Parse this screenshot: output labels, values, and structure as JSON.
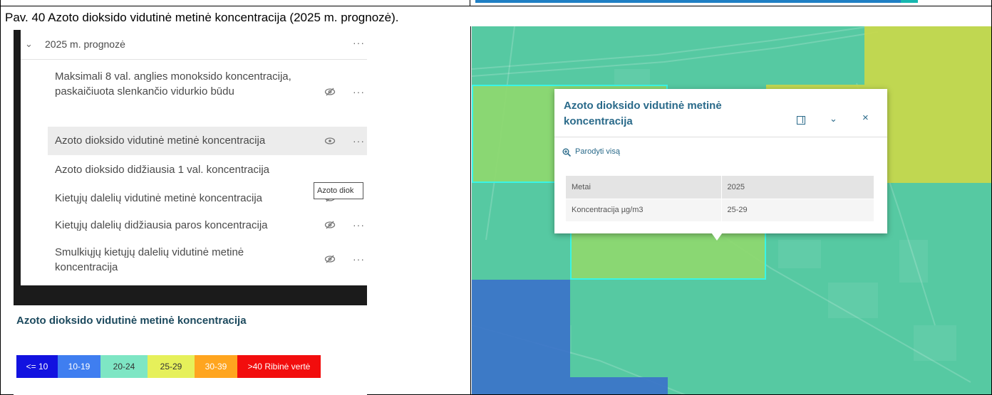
{
  "caption": "Pav. 40 Azoto dioksido vidutinė metinė koncentracija (2025 m. prognozė).",
  "layer_panel": {
    "group": {
      "label": "2025 m. prognozė",
      "expanded": true
    },
    "layers": [
      {
        "label": "Maksimali 8 val. anglies monoksido koncentracija, paskaičiuota slenkančio vidurkio būdu",
        "visible": false
      },
      {
        "label": "Azoto dioksido vidutinė metinė koncentracija",
        "visible": true,
        "selected": true
      },
      {
        "label": "Azoto dioksido didžiausia 1 val. koncentracija",
        "visible": false,
        "tooltip": "Azoto diok"
      },
      {
        "label": "Kietųjų dalelių vidutinė metinė koncentracija",
        "visible": false
      },
      {
        "label": "Kietųjų dalelių didžiausia paros koncentracija",
        "visible": false
      },
      {
        "label": "Smulkiųjų kietųjų dalelių vidutinė metinė koncentracija",
        "visible": false
      }
    ]
  },
  "legend": {
    "title": "Azoto dioksido vidutinė metinė koncentracija",
    "items": [
      {
        "label": "<= 10",
        "color": "#1212e0",
        "text_color": "#ffffff"
      },
      {
        "label": "10-19",
        "color": "#3f7ef0",
        "text_color": "#ffffff"
      },
      {
        "label": "20-24",
        "color": "#7ee6c4",
        "text_color": "#333333"
      },
      {
        "label": "25-29",
        "color": "#e6f05a",
        "text_color": "#333333"
      },
      {
        "label": "30-39",
        "color": "#ffa51f",
        "text_color": "#ffffff"
      },
      {
        "label": ">40 Ribinė vertė",
        "color": "#f20d0d",
        "text_color": "#ffffff"
      }
    ]
  },
  "popup": {
    "title": "Azoto dioksido vidutinė metinė koncentracija",
    "zoom_label": "Parodyti visą",
    "rows": [
      {
        "field": "Metai",
        "value": "2025"
      },
      {
        "field": "Koncentracija µg/m3",
        "value": "25-29"
      }
    ]
  },
  "map_colors": {
    "base": "#56c9a2",
    "lime": "#8ed86f",
    "yellow": "#c9d84a",
    "blue": "#3b73c9",
    "selection": "#39f5e6"
  }
}
